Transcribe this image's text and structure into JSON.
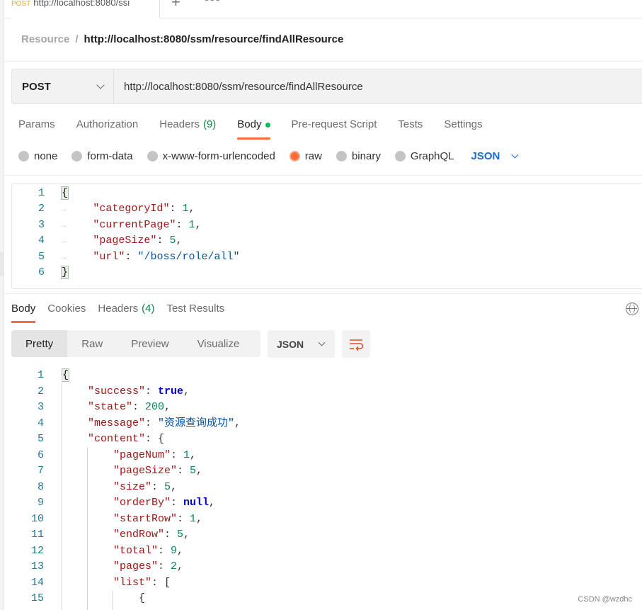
{
  "tab": {
    "method": "POST",
    "url": "http://localhost:8080/ssm/resource/findAllResource",
    "truncated": "http://localhost:8080/ssi"
  },
  "breadcrumb": {
    "parent": "Resource",
    "current": "http://localhost:8080/ssm/resource/findAllResource"
  },
  "request": {
    "method": "POST",
    "url": "http://localhost:8080/ssm/resource/findAllResource"
  },
  "req_tabs": [
    {
      "label": "Params"
    },
    {
      "label": "Authorization"
    },
    {
      "label": "Headers",
      "count": "(9)"
    },
    {
      "label": "Body"
    },
    {
      "label": "Pre-request Script"
    },
    {
      "label": "Tests"
    },
    {
      "label": "Settings"
    }
  ],
  "body_types": [
    {
      "label": "none"
    },
    {
      "label": "form-data"
    },
    {
      "label": "x-www-form-urlencoded"
    },
    {
      "label": "raw",
      "selected": true
    },
    {
      "label": "binary"
    },
    {
      "label": "GraphQL"
    }
  ],
  "body_format": "JSON",
  "request_body": [
    [
      [
        "br",
        "{"
      ]
    ],
    [
      [
        "k",
        "\"categoryId\""
      ],
      [
        "p",
        ": "
      ],
      [
        "n",
        "1"
      ],
      [
        "p",
        ","
      ]
    ],
    [
      [
        "k",
        "\"currentPage\""
      ],
      [
        "p",
        ": "
      ],
      [
        "n",
        "1"
      ],
      [
        "p",
        ","
      ]
    ],
    [
      [
        "k",
        "\"pageSize\""
      ],
      [
        "p",
        ": "
      ],
      [
        "n",
        "5"
      ],
      [
        "p",
        ","
      ]
    ],
    [
      [
        "k",
        "\"url\""
      ],
      [
        "p",
        ": "
      ],
      [
        "s",
        "\"/boss/role/all\""
      ]
    ],
    [
      [
        "br",
        "}"
      ]
    ]
  ],
  "resp_tabs": [
    {
      "label": "Body"
    },
    {
      "label": "Cookies"
    },
    {
      "label": "Headers",
      "count": "(4)"
    },
    {
      "label": "Test Results"
    }
  ],
  "view_modes": [
    "Pretty",
    "Raw",
    "Preview",
    "Visualize"
  ],
  "response_format": "JSON",
  "response_body": [
    {
      "i": 0,
      "t": [
        [
          "br",
          "{"
        ]
      ]
    },
    {
      "i": 1,
      "t": [
        [
          "k",
          "\"success\""
        ],
        [
          "p",
          ": "
        ],
        [
          "b",
          "true"
        ],
        [
          "p",
          ","
        ]
      ]
    },
    {
      "i": 1,
      "t": [
        [
          "k",
          "\"state\""
        ],
        [
          "p",
          ": "
        ],
        [
          "n",
          "200"
        ],
        [
          "p",
          ","
        ]
      ]
    },
    {
      "i": 1,
      "t": [
        [
          "k",
          "\"message\""
        ],
        [
          "p",
          ": "
        ],
        [
          "s",
          "\"资源查询成功\""
        ],
        [
          "p",
          ","
        ]
      ]
    },
    {
      "i": 1,
      "t": [
        [
          "k",
          "\"content\""
        ],
        [
          "p",
          ": {"
        ]
      ]
    },
    {
      "i": 2,
      "t": [
        [
          "k",
          "\"pageNum\""
        ],
        [
          "p",
          ": "
        ],
        [
          "n",
          "1"
        ],
        [
          "p",
          ","
        ]
      ]
    },
    {
      "i": 2,
      "t": [
        [
          "k",
          "\"pageSize\""
        ],
        [
          "p",
          ": "
        ],
        [
          "n",
          "5"
        ],
        [
          "p",
          ","
        ]
      ]
    },
    {
      "i": 2,
      "t": [
        [
          "k",
          "\"size\""
        ],
        [
          "p",
          ": "
        ],
        [
          "n",
          "5"
        ],
        [
          "p",
          ","
        ]
      ]
    },
    {
      "i": 2,
      "t": [
        [
          "k",
          "\"orderBy\""
        ],
        [
          "p",
          ": "
        ],
        [
          "b",
          "null"
        ],
        [
          "p",
          ","
        ]
      ]
    },
    {
      "i": 2,
      "t": [
        [
          "k",
          "\"startRow\""
        ],
        [
          "p",
          ": "
        ],
        [
          "n",
          "1"
        ],
        [
          "p",
          ","
        ]
      ]
    },
    {
      "i": 2,
      "t": [
        [
          "k",
          "\"endRow\""
        ],
        [
          "p",
          ": "
        ],
        [
          "n",
          "5"
        ],
        [
          "p",
          ","
        ]
      ]
    },
    {
      "i": 2,
      "t": [
        [
          "k",
          "\"total\""
        ],
        [
          "p",
          ": "
        ],
        [
          "n",
          "9"
        ],
        [
          "p",
          ","
        ]
      ]
    },
    {
      "i": 2,
      "t": [
        [
          "k",
          "\"pages\""
        ],
        [
          "p",
          ": "
        ],
        [
          "n",
          "2"
        ],
        [
          "p",
          ","
        ]
      ]
    },
    {
      "i": 2,
      "t": [
        [
          "k",
          "\"list\""
        ],
        [
          "p",
          ": ["
        ]
      ]
    },
    {
      "i": 3,
      "t": [
        [
          "p",
          "{"
        ]
      ]
    }
  ],
  "watermark": "CSDN @wzdhc",
  "colors": {
    "accent": "#ff6c37",
    "active_dot": "#0cbb52",
    "json_link": "#1a6bd4"
  }
}
